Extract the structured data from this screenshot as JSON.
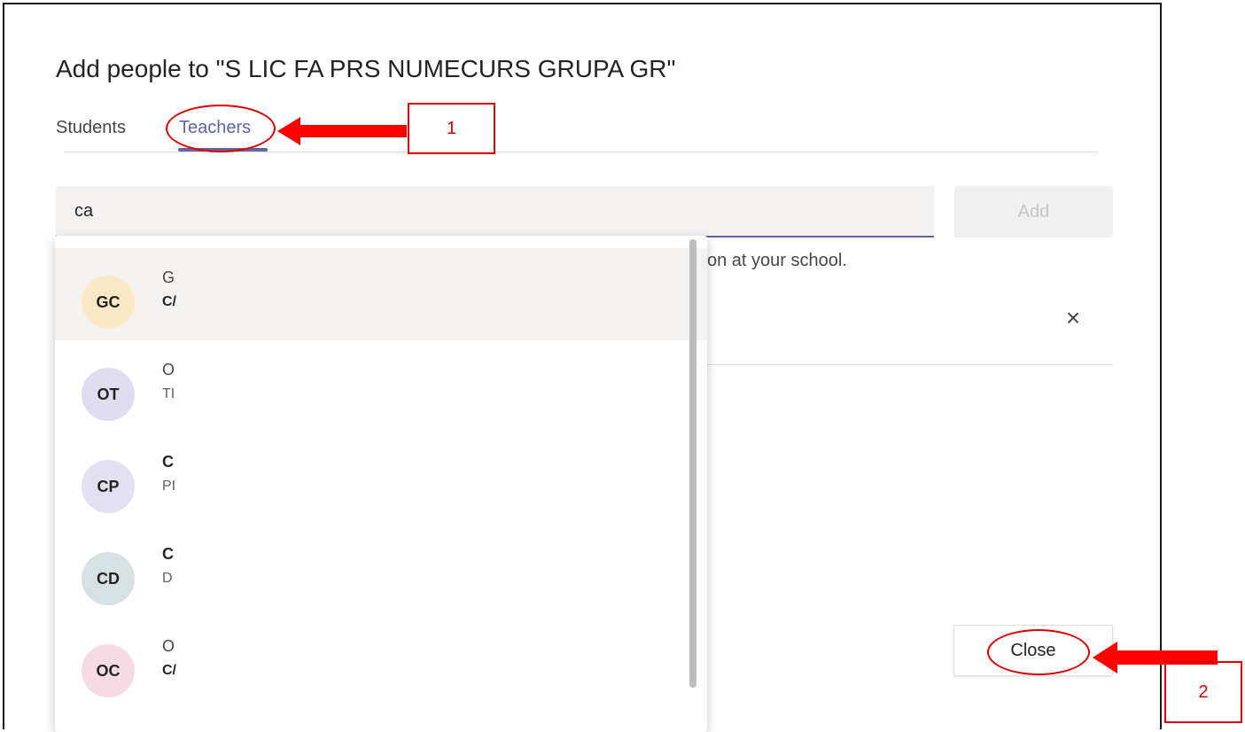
{
  "dialog": {
    "title": "Add people to \"S LIC FA PRS NUMECURS GRUPA GR\"",
    "tabs": [
      {
        "label": "Students",
        "active": false
      },
      {
        "label": "Teachers",
        "active": true
      }
    ],
    "search": {
      "value": "ca",
      "placeholder": ""
    },
    "add_label": "Add",
    "hint_text": "on at your school.",
    "close_icon": "×",
    "close_label": "Close",
    "accent_color": "#6264a7"
  },
  "suggestions": [
    {
      "initials": "GC",
      "avatar_color": "#fbe9c6",
      "line1": "G",
      "line1_bold": false,
      "line2": "C/",
      "line2_bold": true,
      "selected": true
    },
    {
      "initials": "OT",
      "avatar_color": "#e0ddf0",
      "line1": "O",
      "line1_bold": false,
      "line2": "TI",
      "line2_bold": false,
      "selected": false
    },
    {
      "initials": "CP",
      "avatar_color": "#e3e0f1",
      "line1": "C",
      "line1_bold": true,
      "line2": "PI",
      "line2_bold": false,
      "selected": false
    },
    {
      "initials": "CD",
      "avatar_color": "#d7e0e3",
      "line1": "C",
      "line1_bold": true,
      "line2": "D",
      "line2_bold": false,
      "selected": false
    },
    {
      "initials": "OC",
      "avatar_color": "#f6dbe4",
      "line1": "O",
      "line1_bold": false,
      "line2": "C/",
      "line2_bold": true,
      "selected": false
    }
  ],
  "annotations": {
    "box1_label": "1",
    "box2_label": "2",
    "color": "#e00000"
  }
}
